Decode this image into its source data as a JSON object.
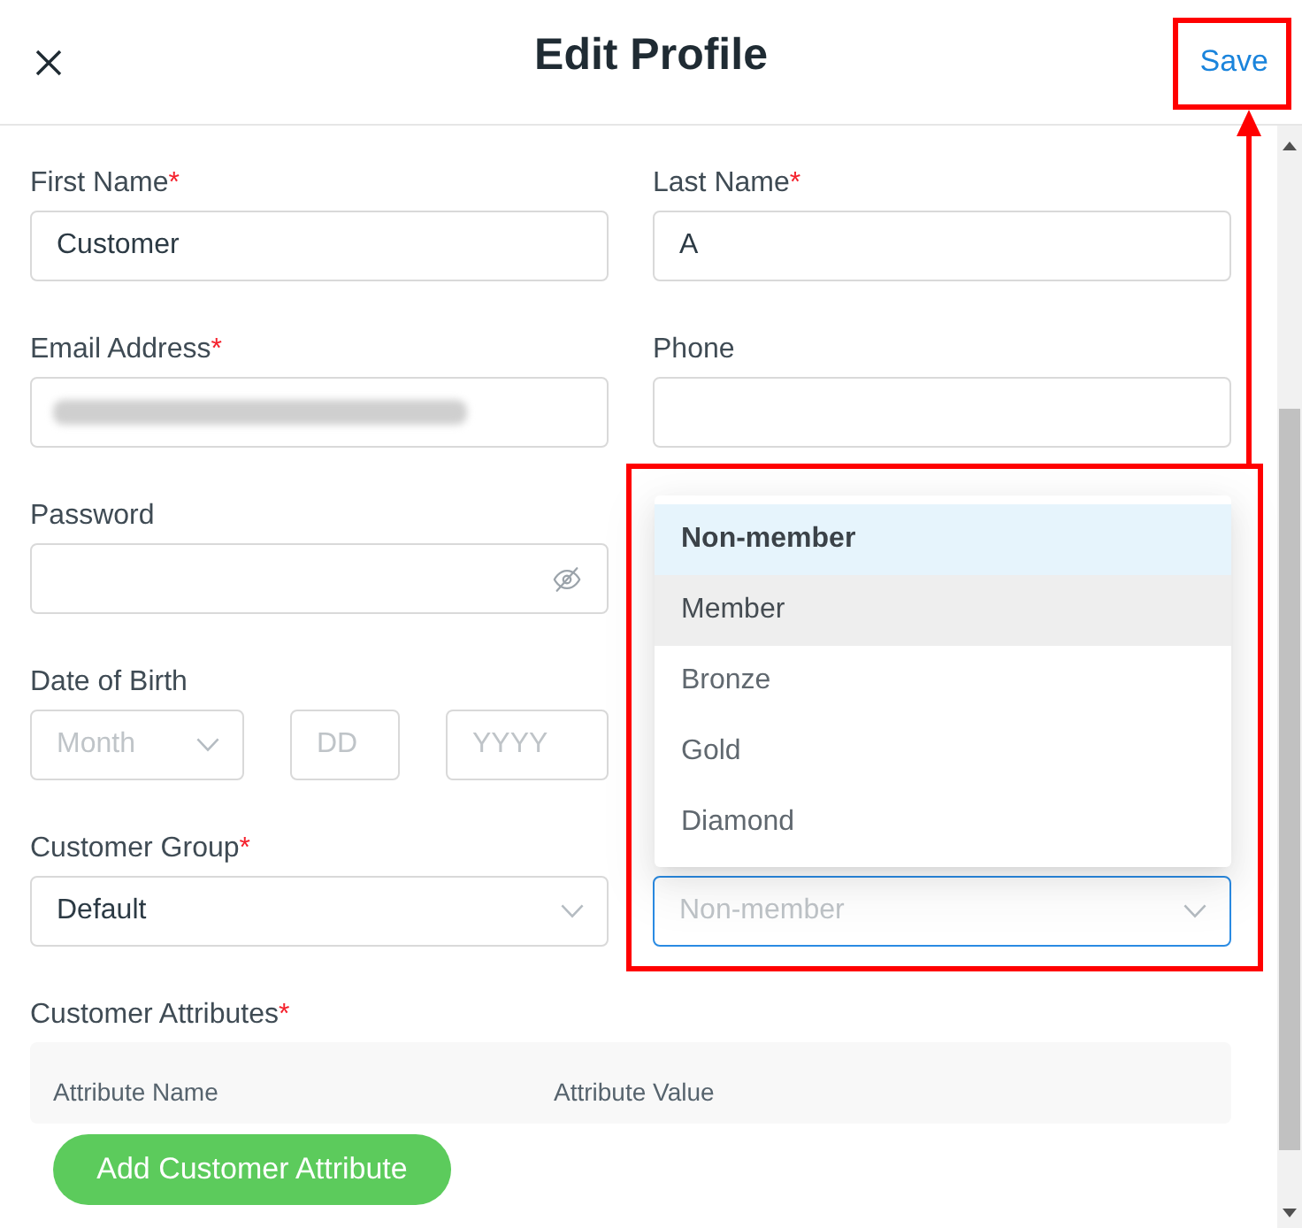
{
  "header": {
    "title": "Edit Profile",
    "save_label": "Save"
  },
  "first_name": {
    "kind": "text",
    "label": "First Name",
    "required_mark": "*",
    "value": "Customer"
  },
  "last_name": {
    "kind": "text",
    "label": "Last Name",
    "required_mark": "*",
    "value": "A"
  },
  "email": {
    "kind": "redacted",
    "label": "Email Address",
    "required_mark": "*"
  },
  "phone": {
    "kind": "text",
    "label": "Phone"
  },
  "password": {
    "kind": "password",
    "label": "Password"
  },
  "date_of_birth": {
    "label": "Date of Birth",
    "parts": [
      {
        "kind": "select",
        "placeholder": "Month"
      },
      {
        "kind": "text",
        "placeholder": "DD"
      },
      {
        "kind": "text",
        "placeholder": "YYYY"
      }
    ]
  },
  "customer_group": {
    "kind": "select",
    "label": "Customer Group",
    "required_mark": "*",
    "value": "Default"
  },
  "membership": {
    "kind": "select",
    "placeholder": "Non-member",
    "focused": true,
    "open": true,
    "options": [
      {
        "label": "Non-member",
        "selected": true,
        "hovered": false
      },
      {
        "label": "Member",
        "selected": false,
        "hovered": true
      },
      {
        "label": "Bronze",
        "selected": false,
        "hovered": false
      },
      {
        "label": "Gold",
        "selected": false,
        "hovered": false
      },
      {
        "label": "Diamond",
        "selected": false,
        "hovered": false
      }
    ]
  },
  "customer_attributes": {
    "label": "Customer Attributes",
    "required_mark": "*",
    "columns": [
      "Attribute Name",
      "Attribute Value"
    ],
    "add_button": "Add Customer Attribute"
  }
}
